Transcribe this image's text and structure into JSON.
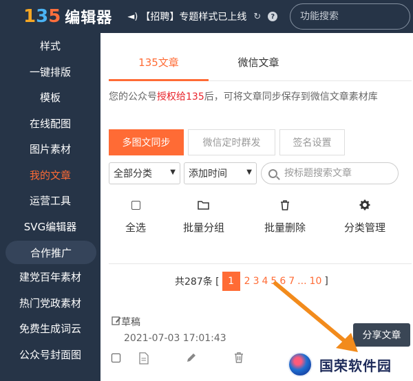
{
  "header": {
    "logo_digits": [
      "1",
      "3",
      "5"
    ],
    "logo_text": "编辑器",
    "announcement": "【招聘】专题样式已上线",
    "search_placeholder": "功能搜索"
  },
  "sidebar": {
    "items": [
      {
        "label": "样式"
      },
      {
        "label": "一键排版"
      },
      {
        "label": "模板"
      },
      {
        "label": "在线配图"
      },
      {
        "label": "图片素材"
      },
      {
        "label": "我的文章",
        "active": true
      },
      {
        "label": "运营工具"
      },
      {
        "label": "SVG编辑器"
      },
      {
        "label": "合作推广"
      },
      {
        "label": "建党百年素材"
      },
      {
        "label": "热门党政素材"
      },
      {
        "label": "免费生成词云"
      },
      {
        "label": "公众号封面图"
      }
    ]
  },
  "main": {
    "tabs": [
      {
        "label": "135文章",
        "active": true
      },
      {
        "label": "微信文章"
      }
    ],
    "notice": {
      "before": "您的公众号",
      "link": "授权给135",
      "after": "后，可将文章同步保存到微信文章素材库"
    },
    "buttons": {
      "multi_sync": "多图文同步",
      "wechat_timer": "微信定时群发",
      "signature": "签名设置"
    },
    "filters": {
      "category": "全部分类",
      "sort": "添加时间",
      "search_placeholder": "按标题搜索文章"
    },
    "actions": {
      "select_all": "全选",
      "batch_group": "批量分组",
      "batch_delete": "批量删除",
      "category_manage": "分类管理"
    },
    "pager": {
      "total": "共287条 [",
      "current": "1",
      "pages": [
        "2",
        "3",
        "4",
        "5",
        "6",
        "7"
      ],
      "ellipsis": "...",
      "last": "10",
      "close": "]"
    },
    "article": {
      "status": "草稿",
      "time": "2021-07-03 17:01:43",
      "share": "分享文章"
    }
  },
  "watermark": {
    "text": "国荣软件园"
  },
  "colors": {
    "sidebar_bg": "#263447",
    "accent": "#ff6b35",
    "link_red": "#e8222a"
  }
}
